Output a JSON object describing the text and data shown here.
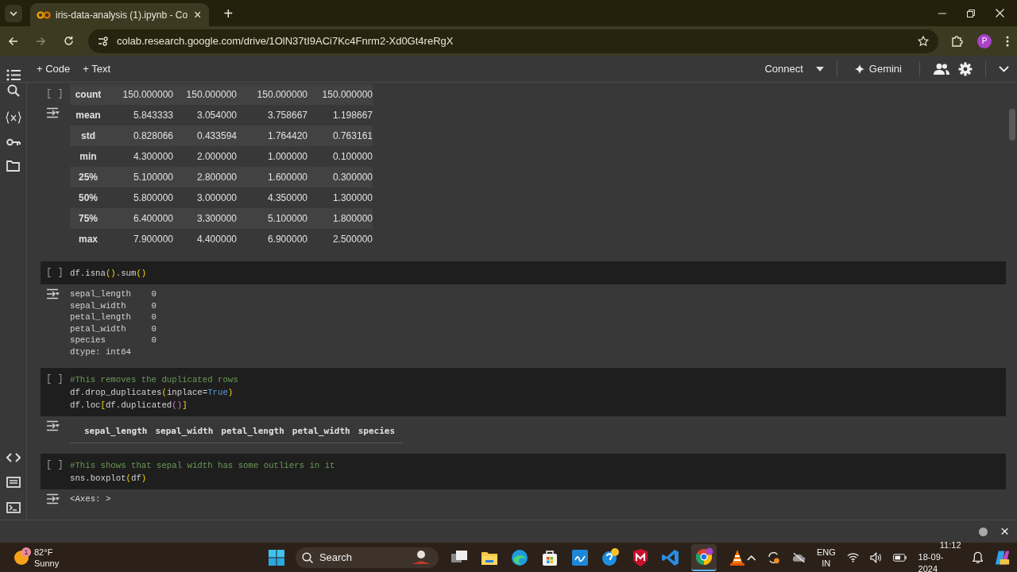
{
  "browser": {
    "tab": {
      "title": "iris-data-analysis (1).ipynb - Co",
      "close": "×"
    },
    "new_tab": "+",
    "url": "colab.research.google.com/drive/1OlN37tI9ACi7Kc4Fnrm2-Xd0Gt4reRgX",
    "profile": "P"
  },
  "toolbar": {
    "add_code": "+ Code",
    "add_text": "+ Text",
    "connect": "Connect",
    "gemini": "Gemini"
  },
  "cells": [
    {
      "kind": "describe",
      "run": "[ ]",
      "rows": [
        {
          "label": "count",
          "values": [
            "150.000000",
            "150.000000",
            "150.000000",
            "150.000000"
          ]
        },
        {
          "label": "mean",
          "values": [
            "5.843333",
            "3.054000",
            "3.758667",
            "1.198667"
          ]
        },
        {
          "label": "std",
          "values": [
            "0.828066",
            "0.433594",
            "1.764420",
            "0.763161"
          ]
        },
        {
          "label": "min",
          "values": [
            "4.300000",
            "2.000000",
            "1.000000",
            "0.100000"
          ]
        },
        {
          "label": "25%",
          "values": [
            "5.100000",
            "2.800000",
            "1.600000",
            "0.300000"
          ]
        },
        {
          "label": "50%",
          "values": [
            "5.800000",
            "3.000000",
            "4.350000",
            "1.300000"
          ]
        },
        {
          "label": "75%",
          "values": [
            "6.400000",
            "3.300000",
            "5.100000",
            "1.800000"
          ]
        },
        {
          "label": "max",
          "values": [
            "7.900000",
            "4.400000",
            "6.900000",
            "2.500000"
          ]
        }
      ]
    },
    {
      "kind": "code",
      "run": "[ ]",
      "lines": [
        [
          {
            "t": "df.isna",
            "kind": "plain"
          },
          {
            "t": "()",
            "kind": "paren"
          },
          {
            "t": ".sum",
            "kind": "plain"
          },
          {
            "t": "()",
            "kind": "paren"
          }
        ]
      ],
      "output": {
        "kind": "text",
        "lines": [
          "sepal_length    0",
          "sepal_width     0",
          "petal_length    0",
          "petal_width     0",
          "species         0",
          "dtype: int64"
        ]
      }
    },
    {
      "kind": "code",
      "run": "[ ]",
      "lines": [
        [
          {
            "t": "#This removes the duplicated rows",
            "kind": "comment"
          }
        ],
        [
          {
            "t": "df.drop_duplicates",
            "kind": "plain"
          },
          {
            "t": "(",
            "kind": "paren"
          },
          {
            "t": "inplace=",
            "kind": "plain"
          },
          {
            "t": "True",
            "kind": "keyword"
          },
          {
            "t": ")",
            "kind": "paren"
          }
        ],
        [
          {
            "t": "df.loc",
            "kind": "plain"
          },
          {
            "t": "[",
            "kind": "paren"
          },
          {
            "t": "df.duplicated",
            "kind": "plain"
          },
          {
            "t": "()",
            "kind": "paren2"
          },
          {
            "t": "]",
            "kind": "paren"
          }
        ]
      ],
      "output": {
        "kind": "header",
        "columns": [
          "sepal_length",
          "sepal_width",
          "petal_length",
          "petal_width",
          "species"
        ]
      }
    },
    {
      "kind": "code",
      "run": "[ ]",
      "lines": [
        [
          {
            "t": "#This shows that sepal width has some outliers in it",
            "kind": "comment"
          }
        ],
        [
          {
            "t": "sns.boxplot",
            "kind": "plain"
          },
          {
            "t": "(",
            "kind": "paren"
          },
          {
            "t": "df",
            "kind": "plain"
          },
          {
            "t": ")",
            "kind": "paren"
          }
        ]
      ],
      "output": {
        "kind": "text",
        "lines": [
          "<Axes: >"
        ]
      }
    }
  ],
  "status_bar": {
    "close": "×"
  },
  "taskbar": {
    "weather": {
      "badge": "1",
      "temp": "82°F",
      "condition": "Sunny"
    },
    "search": "Search",
    "language": "ENG",
    "region": "IN",
    "time": "11:12",
    "date": "18-09-2024"
  }
}
